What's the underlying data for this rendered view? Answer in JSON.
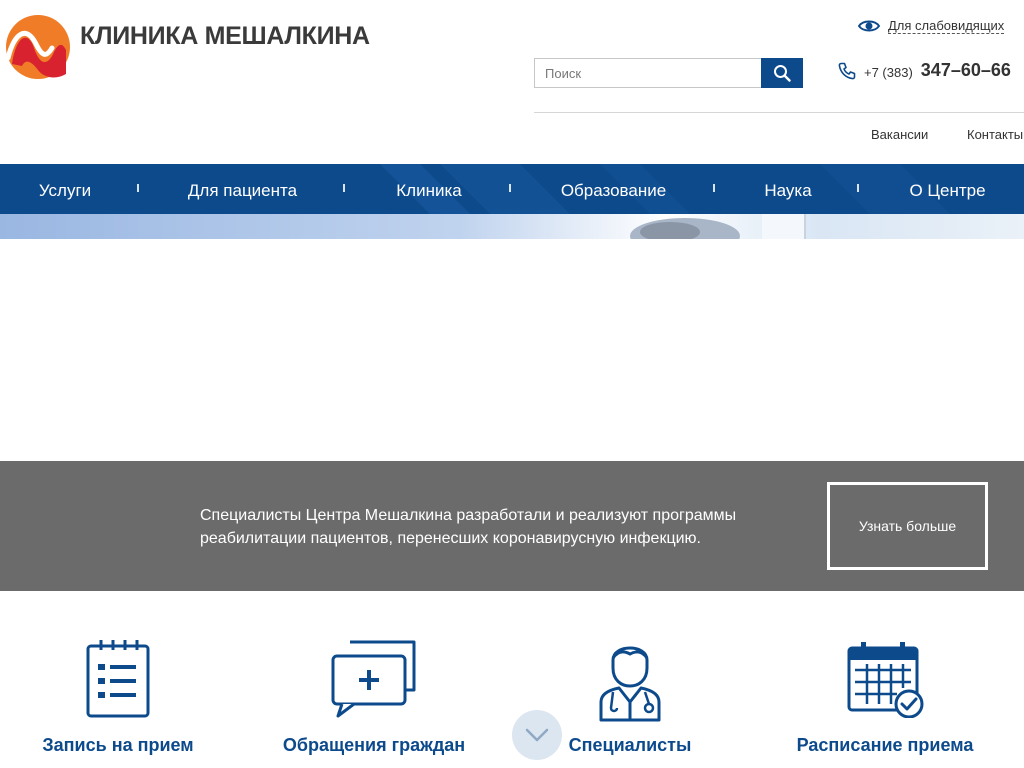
{
  "header": {
    "brand": "КЛИНИКА МЕШАЛКИНА",
    "accessibility_label": "Для слабовидящих",
    "search_placeholder": "Поиск",
    "phone_prefix": "+7 (383)",
    "phone_number": "347–60–66",
    "links": [
      "Вакансии",
      "Контакты"
    ]
  },
  "nav": {
    "items": [
      "Услуги",
      "Для пациента",
      "Клиника",
      "Образование",
      "Наука",
      "О Центре"
    ]
  },
  "banner": {
    "text": "Специалисты Центра Мешалкина разработали и реализуют программы реабилитации пациентов, перенесших коронавирусную инфекцию.",
    "button": "Узнать больше"
  },
  "quick_access": [
    "Запись на прием",
    "Обращения граждан",
    "Специалисты",
    "Расписание приема"
  ],
  "colors": {
    "primary": "#0d4a8c",
    "banner": "#6b6b6b",
    "logo_orange": "#f07c28",
    "logo_red": "#d8222f"
  },
  "icons": [
    "eye-icon",
    "search-icon",
    "phone-icon",
    "checklist-icon",
    "chat-plus-icon",
    "doctor-icon",
    "calendar-check-icon",
    "chevron-down-icon"
  ]
}
